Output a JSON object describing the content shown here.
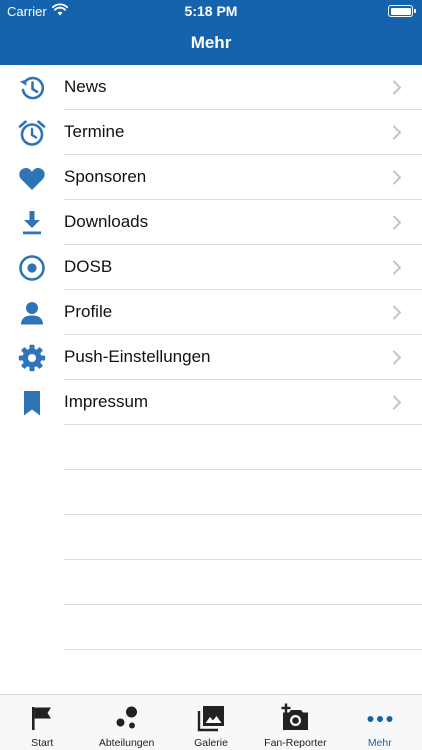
{
  "status_bar": {
    "carrier": "Carrier",
    "time": "5:18 PM"
  },
  "nav": {
    "title": "Mehr"
  },
  "colors": {
    "accent": "#1663ad",
    "icon": "#2f74b6"
  },
  "menu": {
    "items": [
      {
        "label": "News",
        "icon": "history-icon"
      },
      {
        "label": "Termine",
        "icon": "alarm-clock-icon"
      },
      {
        "label": "Sponsoren",
        "icon": "heart-icon"
      },
      {
        "label": "Downloads",
        "icon": "download-icon"
      },
      {
        "label": "DOSB",
        "icon": "radio-target-icon"
      },
      {
        "label": "Profile",
        "icon": "person-icon"
      },
      {
        "label": "Push-Einstellungen",
        "icon": "gear-icon"
      },
      {
        "label": "Impressum",
        "icon": "bookmark-icon"
      }
    ]
  },
  "tabs": {
    "items": [
      {
        "label": "Start",
        "icon": "flag-icon"
      },
      {
        "label": "Abteilungen",
        "icon": "bubbles-icon"
      },
      {
        "label": "Galerie",
        "icon": "gallery-icon"
      },
      {
        "label": "Fan-Reporter",
        "icon": "add-photo-icon"
      },
      {
        "label": "Mehr",
        "icon": "more-dots-icon"
      }
    ],
    "active": "Mehr"
  }
}
